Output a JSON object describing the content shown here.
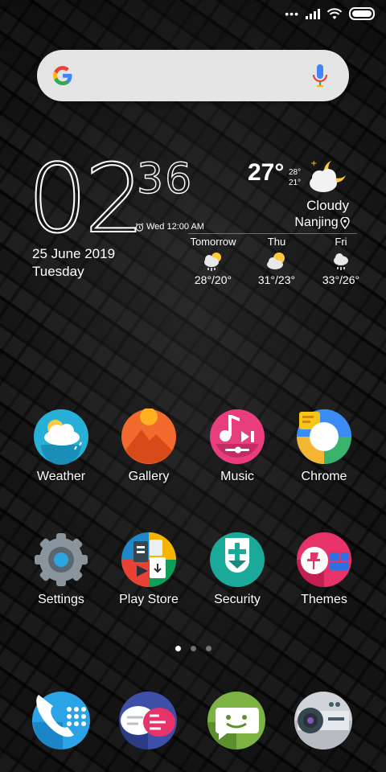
{
  "status_bar": {
    "signal": "signal-icon",
    "wifi": "wifi-icon",
    "battery": "battery-icon"
  },
  "search": {
    "logo": "google-logo",
    "mic": "mic-icon"
  },
  "clock": {
    "hour": "02",
    "minute": "36",
    "alarm": "Wed 12:00 AM",
    "date": "25 June 2019",
    "day": "Tuesday"
  },
  "weather": {
    "temp": "27°",
    "high": "28°",
    "low": "21°",
    "condition": "Cloudy",
    "city": "Nanjing",
    "forecast": [
      {
        "label": "Tomorrow",
        "temps": "28°/20°",
        "icon": "rain-sun-icon"
      },
      {
        "label": "Thu",
        "temps": "31°/23°",
        "icon": "partly-cloudy-icon"
      },
      {
        "label": "Fri",
        "temps": "33°/26°",
        "icon": "cloud-rain-icon"
      }
    ]
  },
  "apps": [
    {
      "label": "Weather",
      "icon": "weather-icon"
    },
    {
      "label": "Gallery",
      "icon": "gallery-icon"
    },
    {
      "label": "Music",
      "icon": "music-icon"
    },
    {
      "label": "Chrome",
      "icon": "chrome-icon"
    },
    {
      "label": "Settings",
      "icon": "settings-icon"
    },
    {
      "label": "Play Store",
      "icon": "play-store-icon"
    },
    {
      "label": "Security",
      "icon": "security-icon"
    },
    {
      "label": "Themes",
      "icon": "themes-icon"
    }
  ],
  "dock": [
    {
      "icon": "phone-icon"
    },
    {
      "icon": "messages-icon"
    },
    {
      "icon": "chat-icon"
    },
    {
      "icon": "camera-icon"
    }
  ],
  "pages": {
    "count": 3,
    "active": 1
  }
}
